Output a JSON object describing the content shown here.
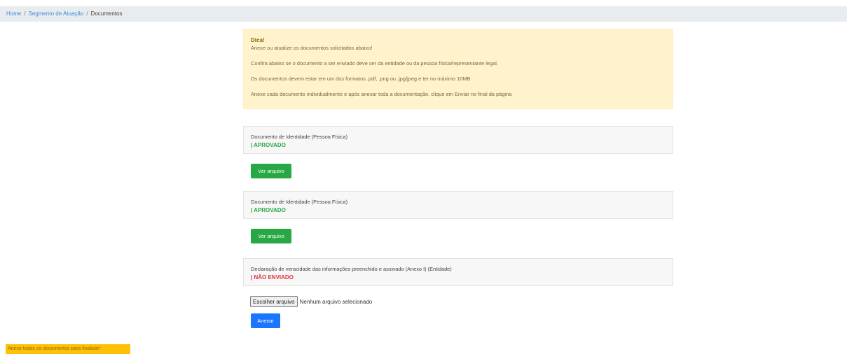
{
  "breadcrumb": {
    "home": "Home",
    "separator": "/",
    "segment": "Segmento de Atuação",
    "current": "Documentos"
  },
  "tip": {
    "title": "Dica!",
    "line1": "Anexe ou atualize os documentos solicitados abaixo!",
    "line2": "Confira abaixo se o documento a ser enviado deve ser da entidade ou da pessoa física/representante legal.",
    "line3": "Os documentos devem estar em um dos formatos .pdf, .png ou .jpg/jpeg e ter no máximo 10MB",
    "line4": "Anexe cada documento individualmente e após anexar toda a documentação, clique em Enviar no final da página"
  },
  "documents": [
    {
      "title": "Documento de Identidade (Pessoa Física)",
      "status": "| APROVADO",
      "action": "Ver arquivo"
    },
    {
      "title": "Documento de Identidade (Pessoa Física)",
      "status": "| APROVADO",
      "action": "Ver arquivo"
    },
    {
      "title": "Declaração de veracidade das informações preenchido e assinado (Anexo I) (Entidade)",
      "status": "| NÃO ENVIADO"
    }
  ],
  "upload": {
    "choose_label": "Escolher arquivo",
    "no_file_text": "Nenhum arquivo selecionado",
    "attach_label": "Anexar"
  },
  "footer": {
    "warning": "Anexe todos os documentos para finalizar!"
  },
  "colors": {
    "approved": "#28a745",
    "not_sent": "#dc3545",
    "tip_bg": "#fff3cd",
    "warning_bg": "#ffc107",
    "primary": "#1a75ff"
  }
}
